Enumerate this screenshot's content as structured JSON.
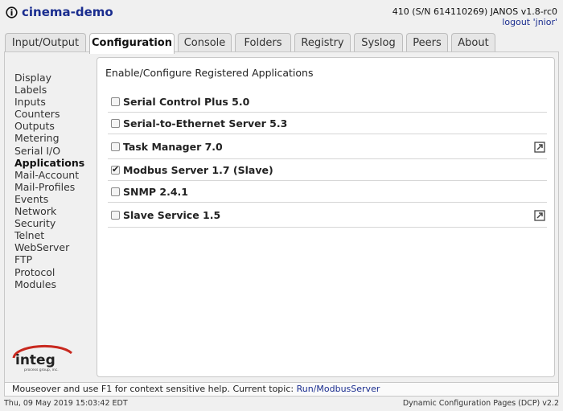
{
  "header": {
    "title": "cinema-demo",
    "device_info": "410 (S/N 614110269) JANOS v1.8-rc0",
    "logout_label": "logout 'jnior'",
    "logo_icon": "info-circle-icon"
  },
  "tabs": [
    {
      "label": "Input/Output"
    },
    {
      "label": "Configuration",
      "active": true
    },
    {
      "label": "Console"
    },
    {
      "label": "Folders"
    },
    {
      "label": "Registry"
    },
    {
      "label": "Syslog"
    },
    {
      "label": "Peers"
    },
    {
      "label": "About"
    }
  ],
  "nav": {
    "items": [
      {
        "label": "Display"
      },
      {
        "label": "Labels"
      },
      {
        "label": "Inputs"
      },
      {
        "label": "Counters"
      },
      {
        "label": "Outputs"
      },
      {
        "label": "Metering"
      },
      {
        "label": "Serial I/O"
      },
      {
        "label": "Applications",
        "active": true
      },
      {
        "label": "Mail-Account"
      },
      {
        "label": "Mail-Profiles"
      },
      {
        "label": "Events"
      },
      {
        "label": "Network"
      },
      {
        "label": "Security"
      },
      {
        "label": "Telnet"
      },
      {
        "label": "WebServer"
      },
      {
        "label": "FTP"
      },
      {
        "label": "Protocol"
      },
      {
        "label": "Modules"
      }
    ],
    "brand_logo": "integ",
    "brand_tagline": "process group, inc."
  },
  "panel": {
    "heading": "Enable/Configure Registered Applications",
    "apps": [
      {
        "name": "Serial Control Plus 5.0",
        "checked": false,
        "has_link": false
      },
      {
        "name": "Serial-to-Ethernet Server 5.3",
        "checked": false,
        "has_link": false
      },
      {
        "name": "Task Manager 7.0",
        "checked": false,
        "has_link": true
      },
      {
        "name": "Modbus Server 1.7 (Slave)",
        "checked": true,
        "has_link": false
      },
      {
        "name": "SNMP 2.4.1",
        "checked": false,
        "has_link": false
      },
      {
        "name": "Slave Service 1.5",
        "checked": false,
        "has_link": true
      }
    ],
    "check_mark": "✔"
  },
  "help": {
    "text": "Mouseover and use F1 for context sensitive help. Current topic: ",
    "topic": "Run/ModbusServer"
  },
  "footer": {
    "timestamp": "Thu, 09 May 2019 15:03:42 EDT",
    "product": "Dynamic Configuration Pages (DCP) v2.2"
  },
  "colors": {
    "brand_blue": "#1a2d8f",
    "integ_red": "#c8281e"
  }
}
